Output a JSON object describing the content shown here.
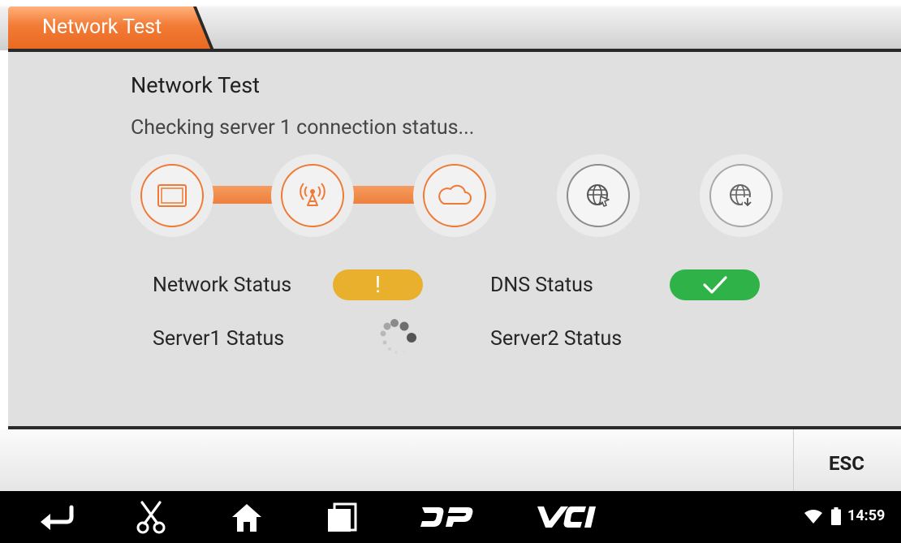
{
  "tab": {
    "label": "Network Test"
  },
  "main": {
    "title": "Network Test",
    "subtitle": "Checking server 1 connection status..."
  },
  "steps": [
    {
      "icon": "tablet-icon",
      "state": "done"
    },
    {
      "icon": "signal-tower-icon",
      "state": "done"
    },
    {
      "icon": "cloud-icon",
      "state": "done"
    },
    {
      "icon": "globe-cursor-icon",
      "state": "pending"
    },
    {
      "icon": "globe-download-icon",
      "state": "pending"
    }
  ],
  "status": {
    "network_label": "Network Status",
    "network_state": "warning",
    "network_symbol": "!",
    "dns_label": "DNS Status",
    "dns_state": "ok",
    "server1_label": "Server1 Status",
    "server1_state": "loading",
    "server2_label": "Server2 Status"
  },
  "actions": {
    "esc_label": "ESC"
  },
  "navbar": {
    "buttons": [
      "back-icon",
      "scissors-icon",
      "home-icon",
      "recent-apps-icon",
      "dp-logo-icon",
      "vci-logo-icon"
    ],
    "time": "14:59"
  },
  "colors": {
    "accent": "#f07a35",
    "warning": "#e8b02c",
    "success": "#2fb349",
    "panel": "#e0e0e0"
  }
}
